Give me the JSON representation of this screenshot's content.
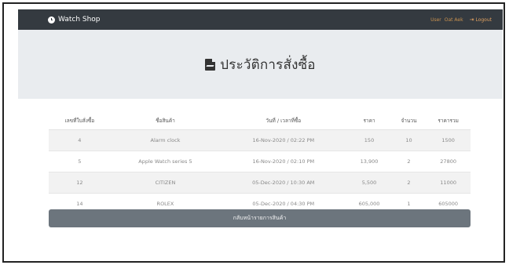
{
  "navbar": {
    "brand": "Watch Shop",
    "user_label": "User",
    "user_name": "Oat Aek",
    "logout_label": "Logout"
  },
  "header": {
    "title": "ประวัติการสั่งซื้อ"
  },
  "table": {
    "columns": [
      "เลขที่ใบสั่งซื้อ",
      "ชื่อสินค้า",
      "วันที่ / เวลาที่ซื้อ",
      "ราคา",
      "จำนวน",
      "ราคารวม"
    ],
    "rows": [
      {
        "id": "4",
        "product": "Alarm clock",
        "datetime": "16-Nov-2020 / 02:22 PM",
        "price": "150",
        "qty": "10",
        "total": "1500"
      },
      {
        "id": "5",
        "product": "Apple Watch series 5",
        "datetime": "16-Nov-2020 / 02:10 PM",
        "price": "13,900",
        "qty": "2",
        "total": "27800"
      },
      {
        "id": "12",
        "product": "CITIZEN",
        "datetime": "05-Dec-2020 / 10:30 AM",
        "price": "5,500",
        "qty": "2",
        "total": "11000"
      },
      {
        "id": "14",
        "product": "ROLEX",
        "datetime": "05-Dec-2020 / 04:30 PM",
        "price": "605,000",
        "qty": "1",
        "total": "605000"
      }
    ]
  },
  "back_button": "กลับหน้ารายการสินค้า"
}
